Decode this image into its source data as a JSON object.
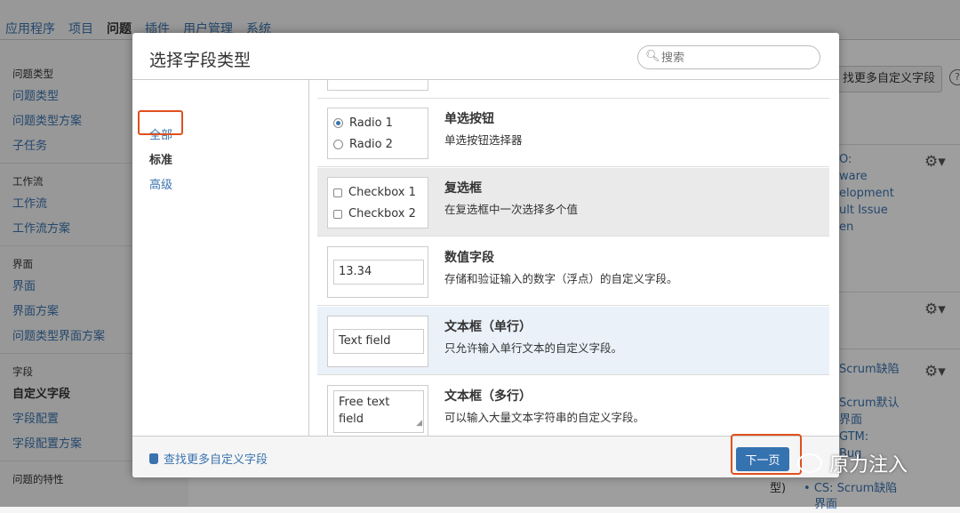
{
  "topnav": {
    "tabs": [
      "应用程序",
      "项目",
      "问题",
      "插件",
      "用户管理",
      "系统"
    ],
    "active_index": 2
  },
  "sidebar": {
    "groups": [
      {
        "heading": "问题类型",
        "links": [
          "问题类型",
          "问题类型方案",
          "子任务"
        ]
      },
      {
        "heading": "工作流",
        "links": [
          "工作流",
          "工作流方案"
        ]
      },
      {
        "heading": "界面",
        "links": [
          "界面",
          "界面方案",
          "问题类型界面方案"
        ]
      },
      {
        "heading": "字段",
        "links": [
          "自定义字段",
          "字段配置",
          "字段配置方案"
        ]
      },
      {
        "heading": "问题的特性",
        "links": []
      }
    ],
    "current_link": "自定义字段"
  },
  "background": {
    "find_more_button": "找更多自定义字段",
    "help_icon": "?",
    "lines1": [
      "O:",
      "ware",
      "elopment",
      "ult Issue",
      "en"
    ],
    "lines2": [
      "Scrum缺陷"
    ],
    "lines3": [
      "Scrum默认",
      "界面",
      "GTM:",
      "Bug"
    ],
    "bottom_left": "型)",
    "bottom_right_1": "CS: Scrum缺陷",
    "bottom_right_2": "界面"
  },
  "dialog": {
    "title": "选择字段类型",
    "search_placeholder": "搜索",
    "nav": [
      "全部",
      "标准",
      "高级"
    ],
    "nav_selected": 1,
    "items": [
      {
        "title": "单选按钮",
        "desc": "单选按钮选择器",
        "preview": [
          "Radio 1",
          "Radio 2"
        ]
      },
      {
        "title": "复选框",
        "desc": "在复选框中一次选择多个值",
        "preview": [
          "Checkbox 1",
          "Checkbox 2"
        ]
      },
      {
        "title": "数值字段",
        "desc": "存储和验证输入的数字（浮点）的自定义字段。",
        "preview": "13.34"
      },
      {
        "title": "文本框（单行）",
        "desc": "只允许输入单行文本的自定义字段。",
        "preview": "Text field"
      },
      {
        "title": "文本框（多行）",
        "desc": "可以输入大量文本字符串的自定义字段。",
        "preview": [
          "Free text",
          "field"
        ]
      }
    ],
    "footer_link": "查找更多自定义字段",
    "next_button": "下一页"
  },
  "watermark": "原力注入",
  "colors": {
    "link": "#3b73af",
    "primary_button": "#3572b0",
    "highlight": "#e0501e"
  }
}
